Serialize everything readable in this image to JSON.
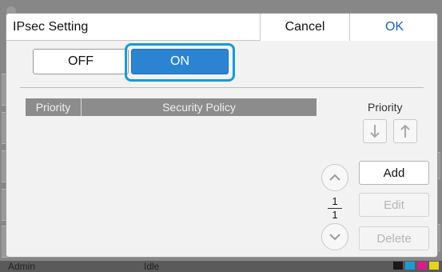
{
  "background": {
    "status_user": "Admin",
    "status_state": "Idle",
    "ink_colors": [
      "#1a1a1a",
      "#1e9ad6",
      "#d61e8c",
      "#e6d31a"
    ]
  },
  "dialog": {
    "title": "IPsec Setting",
    "cancel_label": "Cancel",
    "ok_label": "OK",
    "toggle": {
      "off_label": "OFF",
      "on_label": "ON",
      "selected": "ON"
    },
    "table": {
      "columns": [
        "Priority",
        "Security Policy"
      ],
      "rows": []
    },
    "priority_label": "Priority",
    "icons": {
      "down": "arrow-down-icon",
      "up": "arrow-up-icon",
      "scroll_up": "chevron-up-icon",
      "scroll_down": "chevron-down-icon"
    },
    "page": {
      "current": "1",
      "total": "1"
    },
    "actions": {
      "add_label": "Add",
      "edit_label": "Edit",
      "delete_label": "Delete"
    }
  },
  "colors": {
    "accent": "#2a84d2",
    "focus_ring": "#1a9ad6",
    "ok_text": "#1a5fb4"
  }
}
